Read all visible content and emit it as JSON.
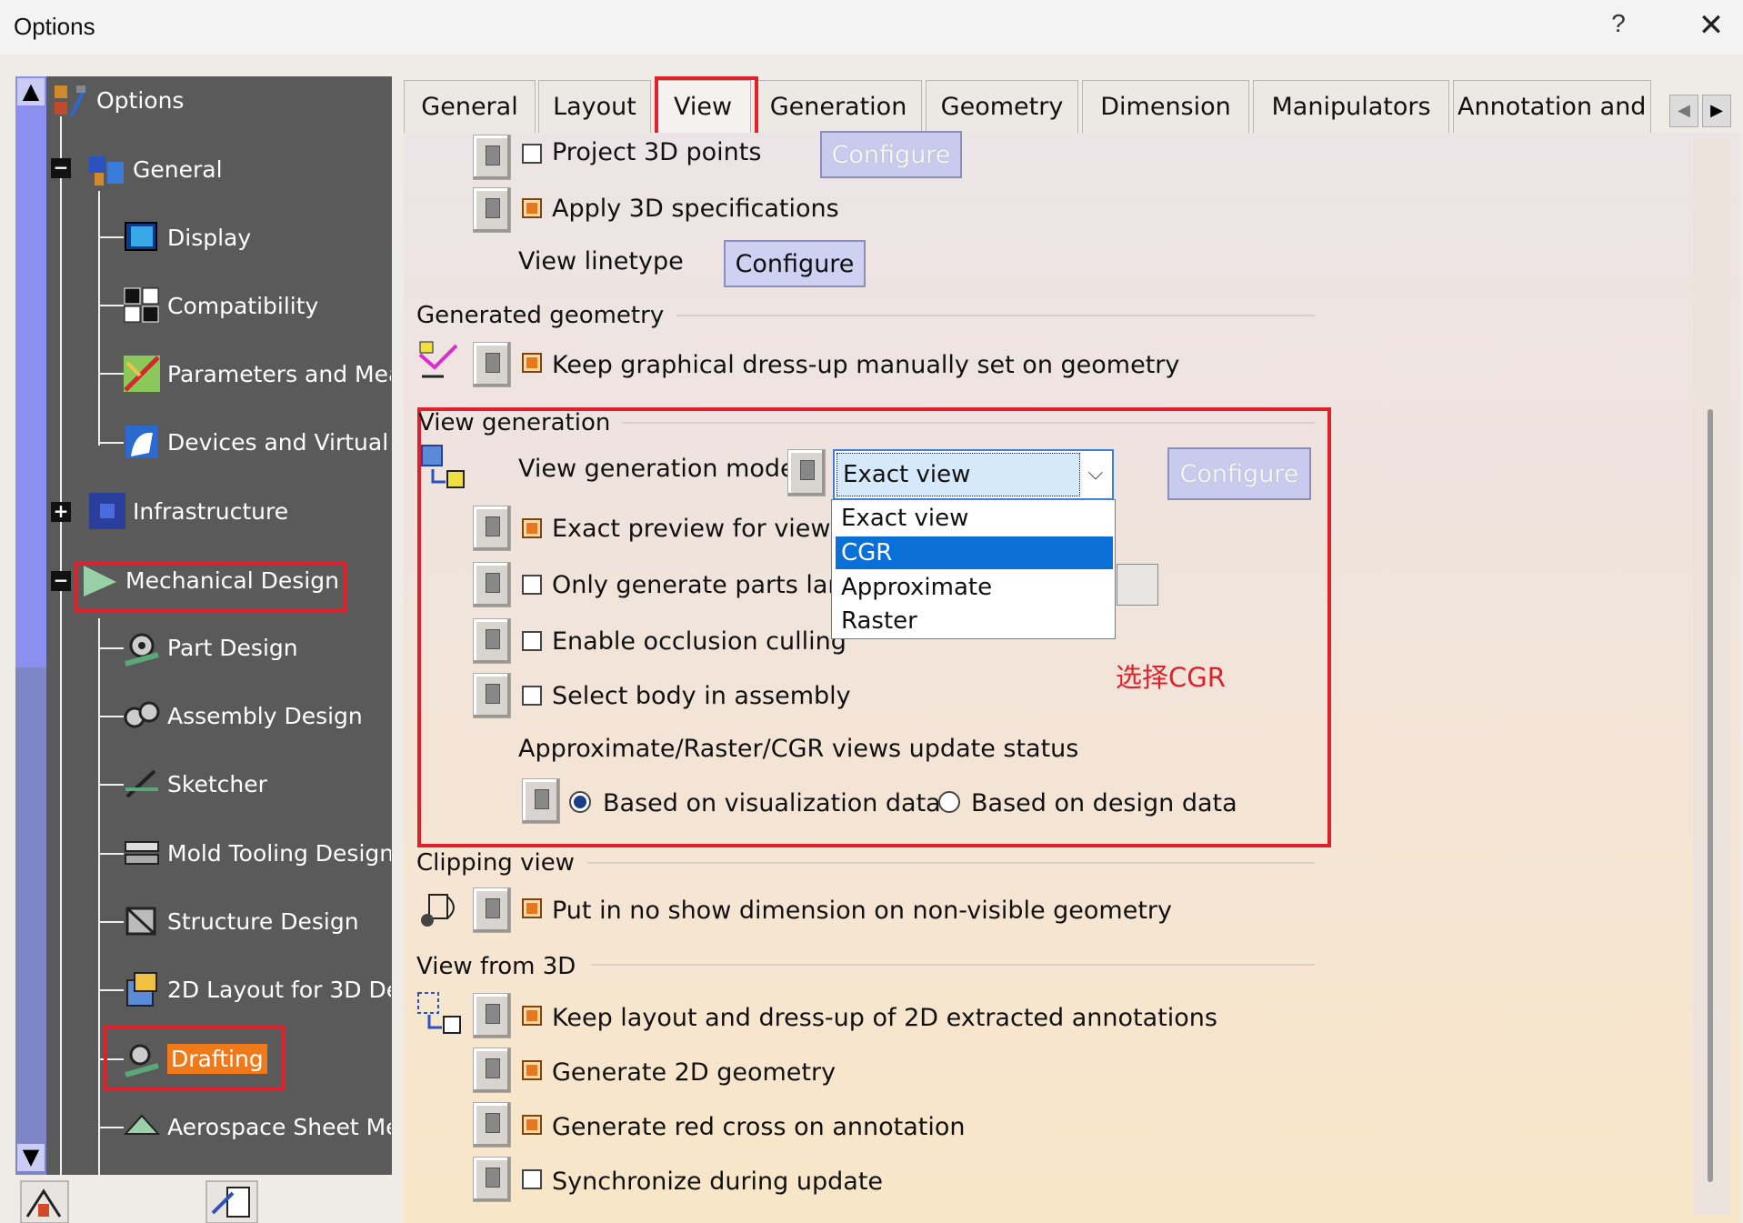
{
  "window": {
    "title": "Options",
    "help": "?",
    "close": "✕"
  },
  "tree": {
    "root": "Options",
    "items": [
      {
        "label": "General",
        "icon": "general-icon"
      },
      {
        "label": "Display",
        "icon": "display-icon"
      },
      {
        "label": "Compatibility",
        "icon": "compatibility-icon"
      },
      {
        "label": "Parameters and Mea",
        "icon": "parameters-icon"
      },
      {
        "label": "Devices and Virtual R",
        "icon": "devices-icon"
      },
      {
        "label": "Infrastructure",
        "icon": "infrastructure-icon"
      },
      {
        "label": "Mechanical Design",
        "icon": "mechanical-design-icon"
      },
      {
        "label": "Part Design",
        "icon": "part-design-icon"
      },
      {
        "label": "Assembly Design",
        "icon": "assembly-design-icon"
      },
      {
        "label": "Sketcher",
        "icon": "sketcher-icon"
      },
      {
        "label": "Mold Tooling Design",
        "icon": "mold-tooling-icon"
      },
      {
        "label": "Structure Design",
        "icon": "structure-design-icon"
      },
      {
        "label": "2D Layout for 3D De",
        "icon": "layout-2d-icon"
      },
      {
        "label": "Drafting",
        "icon": "drafting-icon"
      },
      {
        "label": "Aerospace Sheet Me",
        "icon": "aerospace-sheet-icon"
      }
    ]
  },
  "tabs": [
    "General",
    "Layout",
    "View",
    "Generation",
    "Geometry",
    "Dimension",
    "Manipulators",
    "Annotation and"
  ],
  "active_tab": "View",
  "content": {
    "project_3d_points": "Project 3D points",
    "configure": "Configure",
    "apply_3d_specs": "Apply 3D specifications",
    "view_linetype": "View linetype",
    "generated_geometry": "Generated geometry",
    "keep_graphical": "Keep graphical dress-up manually set on geometry",
    "view_generation": "View generation",
    "view_generation_mode": "View generation mode",
    "mode_value": "Exact view",
    "dropdown_options": [
      "Exact view",
      "CGR",
      "Approximate",
      "Raster"
    ],
    "selected_option": "CGR",
    "exact_preview": "Exact preview for view g",
    "only_generate": "Only generate parts larg",
    "enable_occlusion": "Enable occlusion culling",
    "select_body": "Select body in assembly",
    "update_status": "Approximate/Raster/CGR views update status",
    "based_on_vis": "Based on visualization data",
    "based_on_design": "Based on design data",
    "clipping_view": "Clipping view",
    "put_in_no_show": "Put in no show dimension on non-visible geometry",
    "view_from_3d": "View from 3D",
    "keep_layout": "Keep layout and dress-up of 2D extracted annotations",
    "generate_2d": "Generate 2D geometry",
    "generate_red_cross": "Generate red cross on annotation",
    "synchronize": "Synchronize during update",
    "annotation_note": "选择CGR"
  },
  "colors": {
    "highlight_box": "#e0202a",
    "selected_item": "#0a6fd6",
    "drafting_highlight": "#f07a1a"
  }
}
